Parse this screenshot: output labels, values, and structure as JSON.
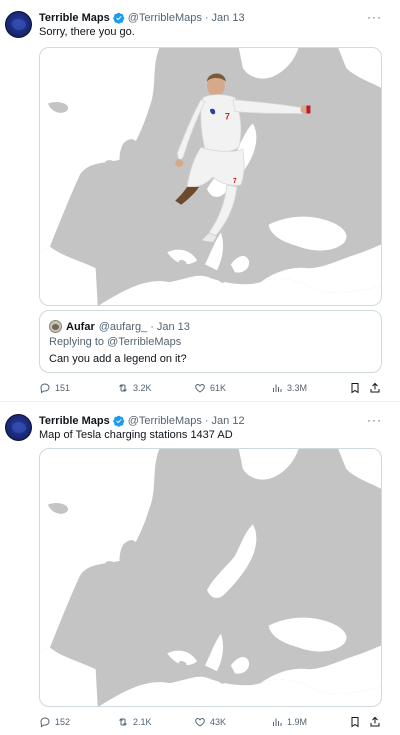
{
  "tweets": [
    {
      "author_name": "Terrible Maps",
      "handle": "@TerribleMaps",
      "separator": "·",
      "date": "Jan 13",
      "text": "Sorry, there you go.",
      "quote": {
        "author_name": "Aufar",
        "handle": "@aufarg_",
        "separator": "·",
        "date": "Jan 13",
        "replying_to": "Replying to @TerribleMaps",
        "text": "Can you add a legend on it?"
      },
      "stats": {
        "replies": "151",
        "reposts": "3.2K",
        "likes": "61K",
        "views": "3.3M"
      }
    },
    {
      "author_name": "Terrible Maps",
      "handle": "@TerribleMaps",
      "separator": "·",
      "date": "Jan 12",
      "text": "Map of Tesla charging stations 1437 AD",
      "stats": {
        "replies": "152",
        "reposts": "2.1K",
        "likes": "43K",
        "views": "1.9M"
      }
    }
  ],
  "more_glyph": "···",
  "colors": {
    "verified": "#1d9bf0",
    "land": "#c4c4c4",
    "muted": "#536471",
    "jersey_number": "#d41e2a"
  },
  "icons": [
    "verified-icon",
    "more-icon",
    "reply-icon",
    "repost-icon",
    "like-icon",
    "views-icon",
    "bookmark-icon",
    "share-icon"
  ]
}
